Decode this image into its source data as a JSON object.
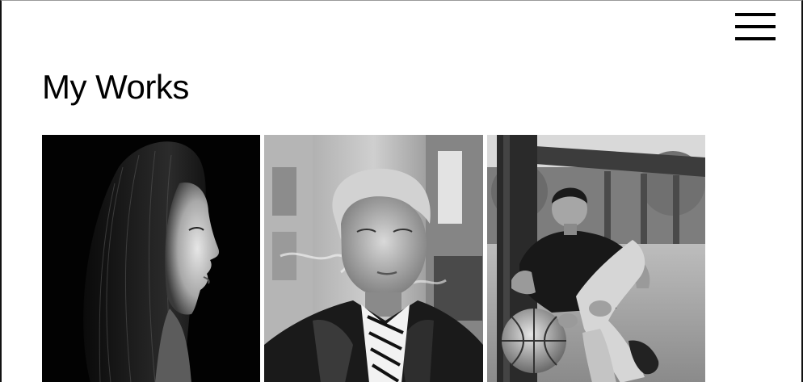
{
  "header": {
    "menu_icon": "hamburger-menu-icon"
  },
  "main": {
    "title": "My Works"
  },
  "gallery": {
    "items": [
      {
        "subject": "portrait-woman-profile",
        "tone": "black-and-white"
      },
      {
        "subject": "portrait-young-man-leather-jacket",
        "tone": "black-and-white"
      },
      {
        "subject": "portrait-boy-with-basketball",
        "tone": "black-and-white"
      }
    ]
  },
  "colors": {
    "background": "#ffffff",
    "text": "#000000",
    "menu": "#000000"
  }
}
